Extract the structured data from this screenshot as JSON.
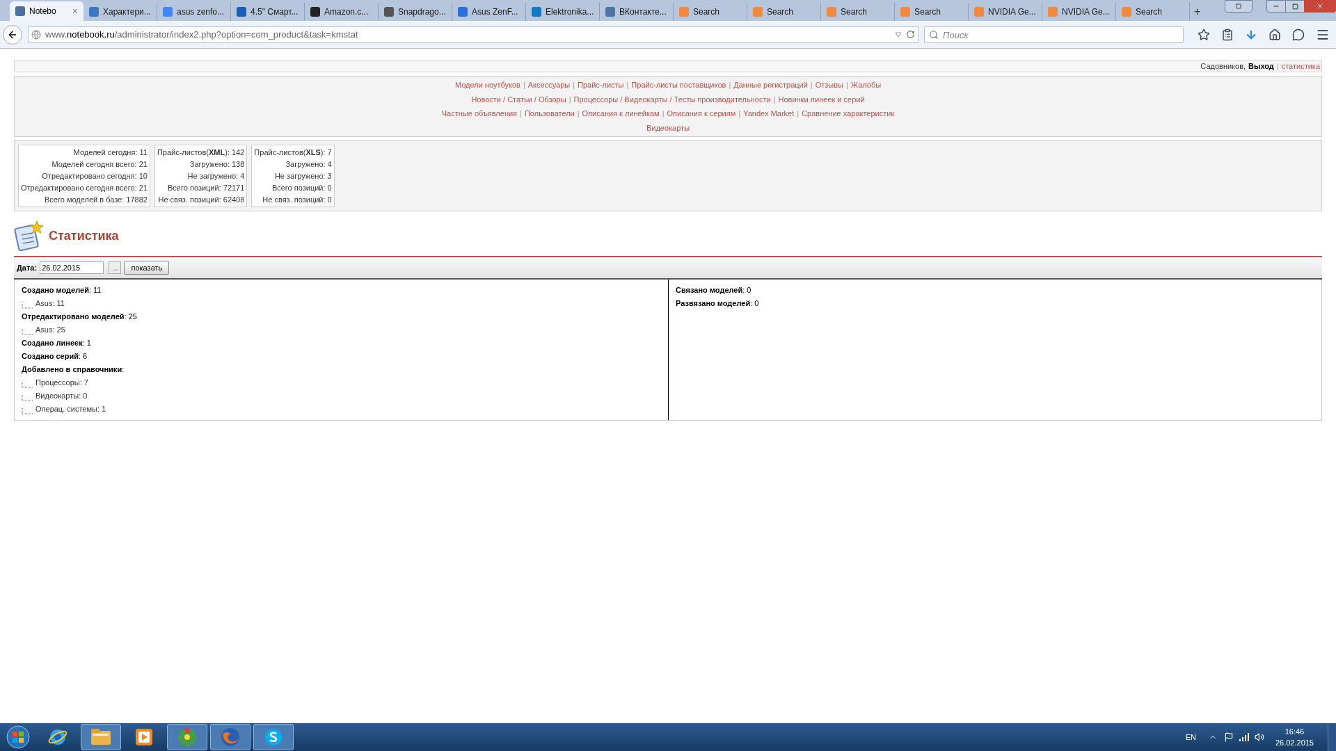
{
  "browser": {
    "tabs": [
      {
        "title": "Notebo",
        "selected": true,
        "color": "#4a6fa5",
        "close": "×"
      },
      {
        "title": "Характери...",
        "selected": false,
        "color": "#3a78c2"
      },
      {
        "title": "asus zenfo...",
        "selected": false,
        "color": "#4285f4"
      },
      {
        "title": "4.5\" Смарт...",
        "selected": false,
        "color": "#1a5fb4"
      },
      {
        "title": "Amazon.c...",
        "selected": false,
        "color": "#222222"
      },
      {
        "title": "Snapdrago...",
        "selected": false,
        "color": "#555555"
      },
      {
        "title": "Asus ZenF...",
        "selected": false,
        "color": "#2a6fdb"
      },
      {
        "title": "Elektronika...",
        "selected": false,
        "color": "#1479c4"
      },
      {
        "title": "ВКонтакте...",
        "selected": false,
        "color": "#4c75a3"
      },
      {
        "title": "Search",
        "selected": false,
        "color": "#f0883e"
      },
      {
        "title": "Search",
        "selected": false,
        "color": "#f0883e"
      },
      {
        "title": "Search",
        "selected": false,
        "color": "#f0883e"
      },
      {
        "title": "Search",
        "selected": false,
        "color": "#f0883e"
      },
      {
        "title": "NVIDIA Ge...",
        "selected": false,
        "color": "#f0883e"
      },
      {
        "title": "NVIDIA Ge...",
        "selected": false,
        "color": "#f0883e"
      },
      {
        "title": "Search",
        "selected": false,
        "color": "#f0883e"
      }
    ],
    "new_tab": "+",
    "url": "www.**notebook.ru**/administrator/index2.php?option=com_product&task=kmstat",
    "search": {
      "placeholder": "Поиск"
    }
  },
  "page": {
    "user_bar": {
      "user": "Садовников,",
      "logout": "Выход",
      "separator": "|",
      "link": "статистика"
    },
    "nav": {
      "separator": "|",
      "lines": [
        {
          "links": [
            "Модели ноутбуков",
            "Аксессуары",
            "Прайс-листы",
            "Прайс-листы поставщиков",
            "Данные регистраций",
            "Отзывы",
            "Жалобы"
          ]
        },
        {
          "links": [
            "Новости / Статьи / Обзоры",
            "Процессоры / Видеокарты / Тесты производительности",
            "Новинки линеек и серий"
          ]
        },
        {
          "links": [
            "Частные объявления",
            "Пользователи",
            "Описания к линейкам",
            "Описания к сериям",
            "Yandex Market",
            "Сравнение характеристик"
          ]
        },
        {
          "links": [
            "Видеокарты"
          ]
        }
      ]
    },
    "stats": [
      [
        "Моделей сегодня: 11",
        "Моделей сегодня всего: 21",
        "Отредактировано сегодня: 10",
        "Отредактировано сегодня всего: 21",
        "Всего моделей в базе: 17882"
      ],
      [
        "Прайс-листов(**XML**): 142",
        "Загружено: 138",
        "Не загружено: 4",
        "Всего позиций: 72171",
        "Не связ. позиций: 62408"
      ],
      [
        "Прайс-листов(**XLS**): 7",
        "Загружено: 4",
        "Не загружено: 3",
        "Всего позиций: 0",
        "Не связ. позиций: 0"
      ]
    ],
    "heading": "Статистика",
    "filter": {
      "label": "Дата:",
      "value": "26.02.2015",
      "picker": "...",
      "submit": "показать"
    },
    "left": [
      {
        "text": "**Создано моделей**: 11",
        "children": [
          {
            "text": "Asus: 11"
          }
        ]
      },
      {
        "text": "**Отредактировано моделей**: 25",
        "children": [
          {
            "text": "Asus: 25"
          }
        ]
      },
      {
        "text": "**Создано линеек**: 1"
      },
      {
        "text": "**Создано серий**: 6"
      },
      {
        "text": "**Добавлено в справочники**:",
        "children": [
          {
            "text": "Процессоры: 7"
          },
          {
            "text": "Видеокарты: 0"
          },
          {
            "text": "Операц. системы: 1"
          }
        ]
      }
    ],
    "right": [
      "**Связано моделей**: 0",
      "**Развязано моделей**: 0"
    ]
  },
  "taskbar": {
    "apps": [
      {
        "kind": "ie",
        "running": false
      },
      {
        "kind": "explorer",
        "running": true
      },
      {
        "kind": "media",
        "running": false
      },
      {
        "kind": "icq",
        "running": true
      },
      {
        "kind": "firefox",
        "running": true
      },
      {
        "kind": "skype",
        "running": true
      }
    ],
    "language": "EN",
    "time": "16:46",
    "date": "26.02.2015"
  }
}
